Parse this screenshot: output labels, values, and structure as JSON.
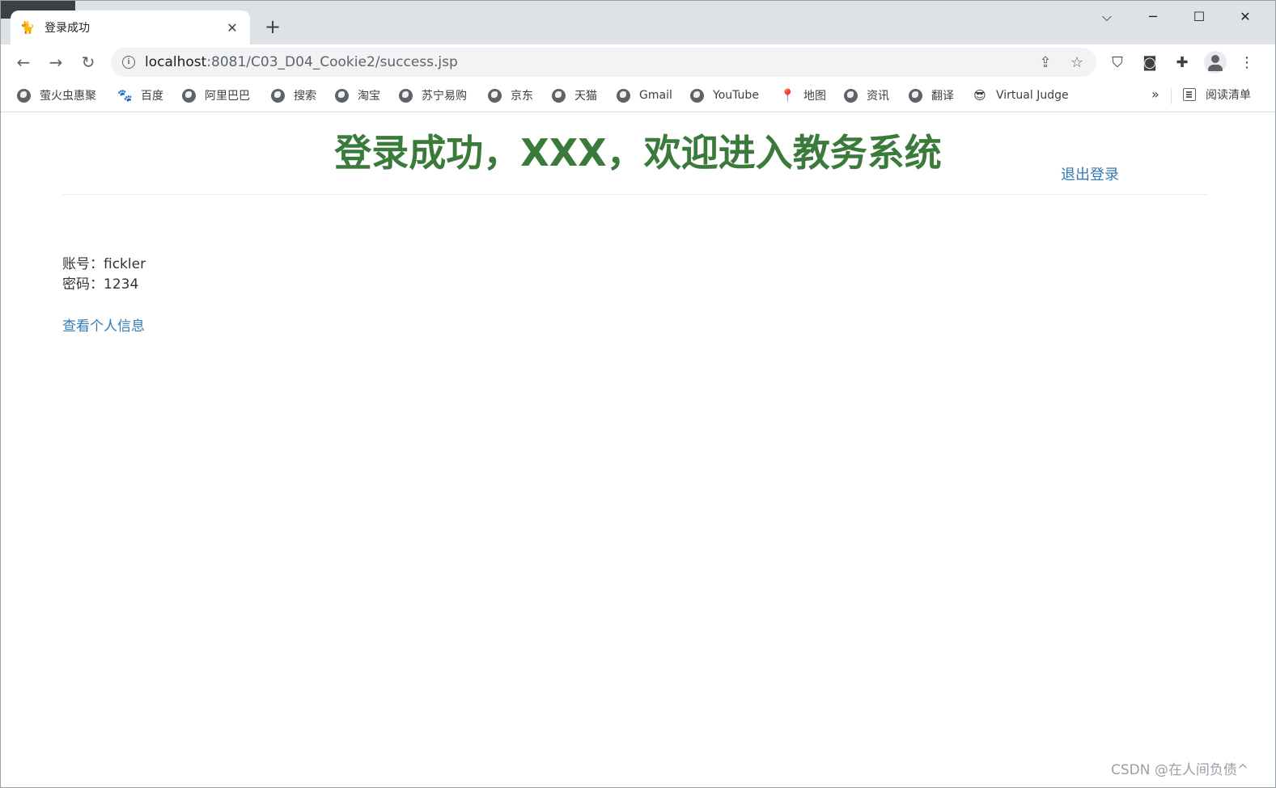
{
  "browser": {
    "tab_title": "登录成功",
    "tab_favicon": "tomcat-icon",
    "url_host": "localhost",
    "url_rest": ":8081/C03_D04_Cookie2/success.jsp",
    "reading_list_label": "阅读清单",
    "bookmarks_overflow": "»",
    "bookmarks": [
      {
        "label": "萤火虫惠聚",
        "icon": "globe-icon"
      },
      {
        "label": "百度",
        "icon": "baidu-icon"
      },
      {
        "label": "阿里巴巴",
        "icon": "globe-icon"
      },
      {
        "label": "搜索",
        "icon": "globe-icon"
      },
      {
        "label": "淘宝",
        "icon": "globe-icon"
      },
      {
        "label": "苏宁易购",
        "icon": "globe-icon"
      },
      {
        "label": "京东",
        "icon": "globe-icon"
      },
      {
        "label": "天猫",
        "icon": "globe-icon"
      },
      {
        "label": "Gmail",
        "icon": "globe-icon"
      },
      {
        "label": "YouTube",
        "icon": "globe-icon"
      },
      {
        "label": "地图",
        "icon": "maps-icon"
      },
      {
        "label": "资讯",
        "icon": "globe-icon"
      },
      {
        "label": "翻译",
        "icon": "globe-icon"
      },
      {
        "label": "Virtual Judge",
        "icon": "vjudge-icon"
      }
    ]
  },
  "page": {
    "headline": "登录成功，XXX，欢迎进入教务系统",
    "logout_link": "退出登录",
    "account_line": "账号：fickler",
    "password_line": "密码：1234",
    "profile_link": "查看个人信息",
    "heading_color": "#3a7a3a",
    "link_color": "#337ab7"
  },
  "watermark": "CSDN @在人间负债^"
}
